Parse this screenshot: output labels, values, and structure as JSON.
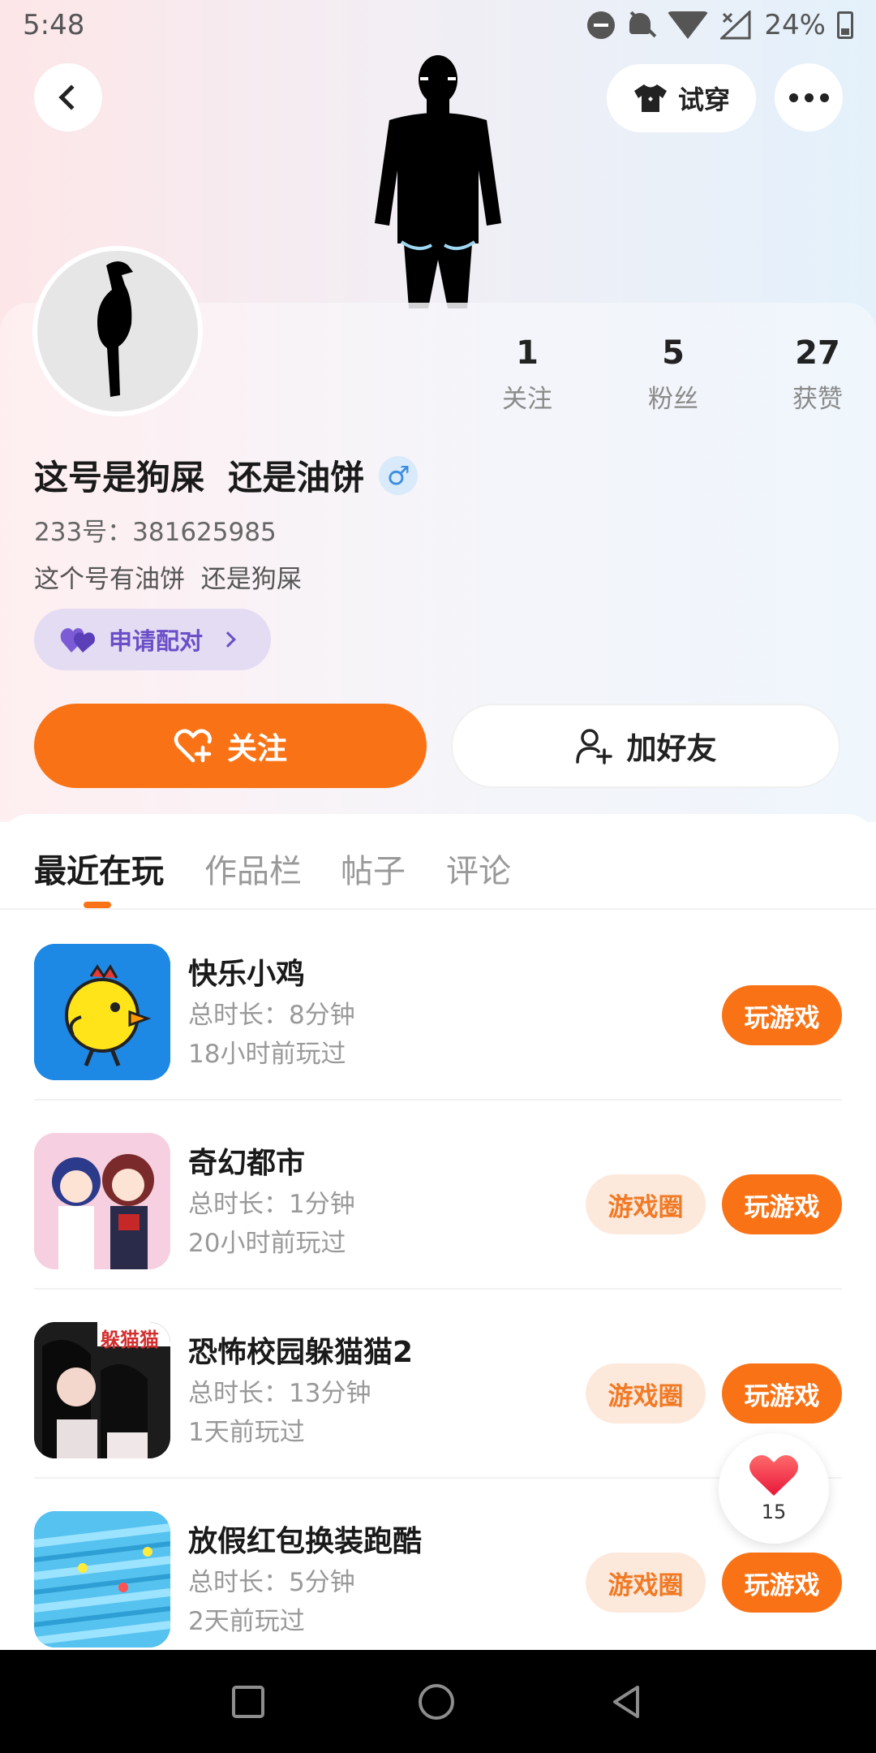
{
  "status_bar": {
    "time": "5:48",
    "battery": "24%"
  },
  "header": {
    "tryon_label": "试穿"
  },
  "profile": {
    "stats": [
      {
        "value": "1",
        "label": "关注"
      },
      {
        "value": "5",
        "label": "粉丝"
      },
      {
        "value": "27",
        "label": "获赞"
      }
    ],
    "name": "这号是狗屎  还是油饼",
    "gender_symbol": "♂",
    "id_text": "233号：381625985",
    "bio": "这个号有油饼  还是狗屎",
    "pair_label": "申请配对",
    "follow_label": "关注",
    "add_friend_label": "加好友"
  },
  "tabs": [
    {
      "label": "最近在玩",
      "active": true
    },
    {
      "label": "作品栏",
      "active": false
    },
    {
      "label": "帖子",
      "active": false
    },
    {
      "label": "评论",
      "active": false
    }
  ],
  "games": [
    {
      "title": "快乐小鸡",
      "duration": "总时长：8分钟",
      "last_played": "18小时前玩过",
      "has_circle": false,
      "circle_label": "",
      "play_label": "玩游戏"
    },
    {
      "title": "奇幻都市",
      "duration": "总时长：1分钟",
      "last_played": "20小时前玩过",
      "has_circle": true,
      "circle_label": "游戏圈",
      "play_label": "玩游戏"
    },
    {
      "title": "恐怖校园躲猫猫2",
      "duration": "总时长：13分钟",
      "last_played": "1天前玩过",
      "has_circle": true,
      "circle_label": "游戏圈",
      "play_label": "玩游戏"
    },
    {
      "title": "放假红包换装跑酷",
      "duration": "总时长：5分钟",
      "last_played": "2天前玩过",
      "has_circle": true,
      "circle_label": "游戏圈",
      "play_label": "玩游戏"
    }
  ],
  "game3_icon_text": "躲猫猫",
  "like_fab": {
    "count": "15"
  },
  "colors": {
    "accent": "#f97316",
    "pair": "#6a4fc8",
    "circle_bg": "#fde9dc"
  }
}
